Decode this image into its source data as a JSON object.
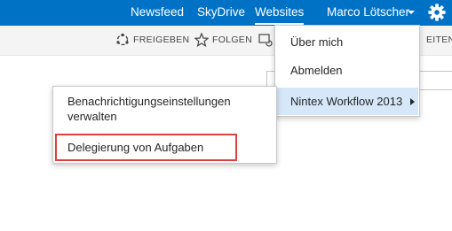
{
  "suite_bar": {
    "links": [
      "Newsfeed",
      "SkyDrive",
      "Websites"
    ],
    "user_name": "Marco Lötscher",
    "background_color": "#0072c6"
  },
  "actions": {
    "share": "FREIGEBEN",
    "follow": "FOLGEN",
    "edit_partial": "EITEN"
  },
  "user_menu": {
    "items": [
      "Über mich",
      "Abmelden",
      "Nintex Workflow 2013"
    ]
  },
  "nintex_submenu": {
    "item_1_line_1": "Benachrichtigungseinstellungen",
    "item_1_line_2": "verwalten",
    "item_2": "Delegierung von Aufgaben"
  },
  "colors": {
    "highlight": "#d5e7f8",
    "annotation_red": "#e04040"
  },
  "icons": {
    "gear": "gear-icon",
    "share": "share-icon",
    "follow": "star-icon",
    "sync": "sync-icon"
  }
}
